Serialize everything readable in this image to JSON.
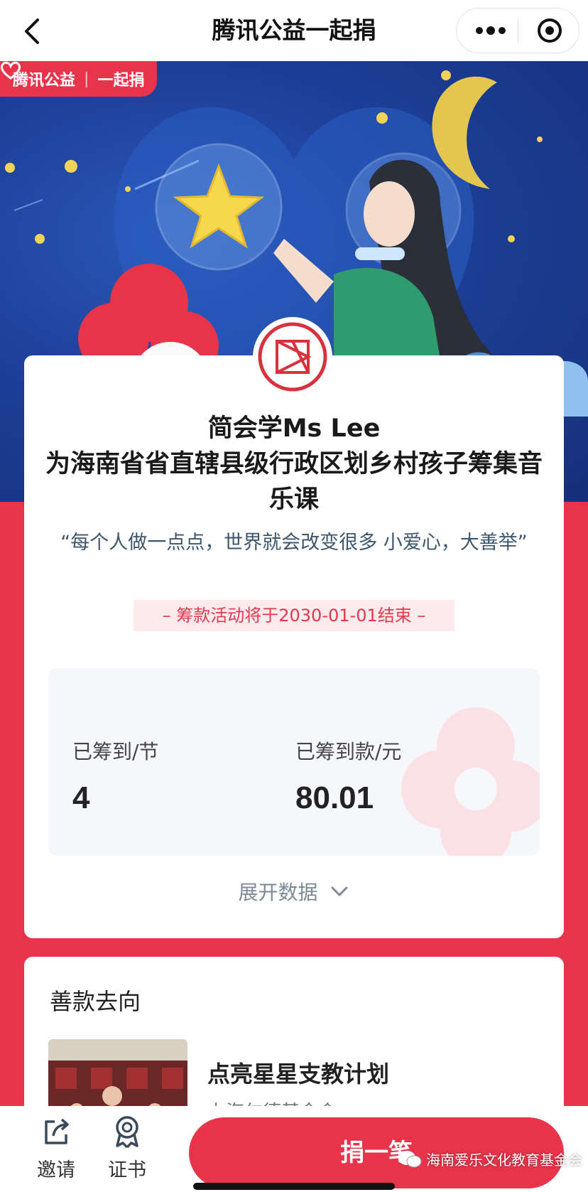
{
  "navbar": {
    "title": "腾讯公益一起捐",
    "back_icon": "chevron-left-icon",
    "more_icon": "more-dots-icon",
    "close_icon": "target-close-icon"
  },
  "banner": {
    "brand": "腾讯公益",
    "campaign": "一起捐",
    "brand_color": "#e8344a"
  },
  "project": {
    "creator": "简会学Ms Lee",
    "title": "为海南省省直辖县级行政区划乡村孩子筹集音乐课",
    "slogan": "“每个人做一点点，世界就会改变很多 小爱心，大善举”",
    "deadline": "– 筹款活动将于2030-01-01结束 –"
  },
  "stats": [
    {
      "label": "已筹到/节",
      "value": "4"
    },
    {
      "label": "已筹到款/元",
      "value": "80.01"
    }
  ],
  "expand_label": "展开数据",
  "destination": {
    "heading": "善款去向",
    "project_name": "点亮星星支教计划",
    "organization": "上海仁德基金会"
  },
  "bottom": {
    "invite_label": "邀请",
    "certificate_label": "证书",
    "donate_label": "捐一笔",
    "watermark": "海南爱乐文化教育基金会"
  },
  "colors": {
    "accent": "#e8344a",
    "sky": "#1d3f98",
    "deadline_bg": "#fdeaec"
  }
}
